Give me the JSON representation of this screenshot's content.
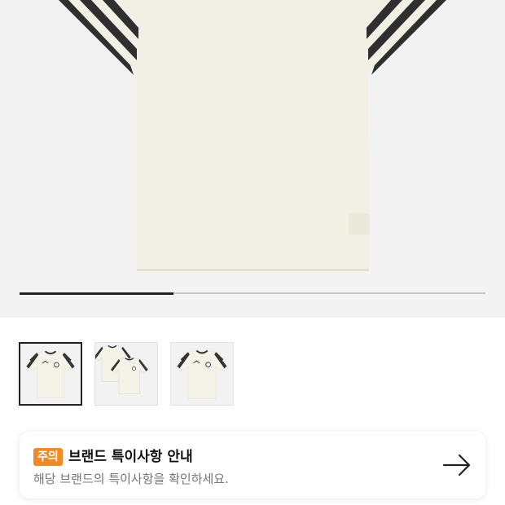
{
  "gallery": {
    "progress_fraction": 0.33,
    "thumbnails": [
      {
        "selected": true,
        "shirts": 1
      },
      {
        "selected": false,
        "shirts": 2
      },
      {
        "selected": false,
        "shirts": 1
      }
    ]
  },
  "notice": {
    "badge": "주의",
    "title": "브랜드 특이사항 안내",
    "subtitle": "해당 브랜드의 특이사항을 확인하세요.",
    "arrow_icon": "arrow-right-icon"
  },
  "colors": {
    "shirt": "#f2efe4",
    "stripe": "#2f2f2f",
    "badge": "#f08a24",
    "background": "#f3f3f3"
  }
}
